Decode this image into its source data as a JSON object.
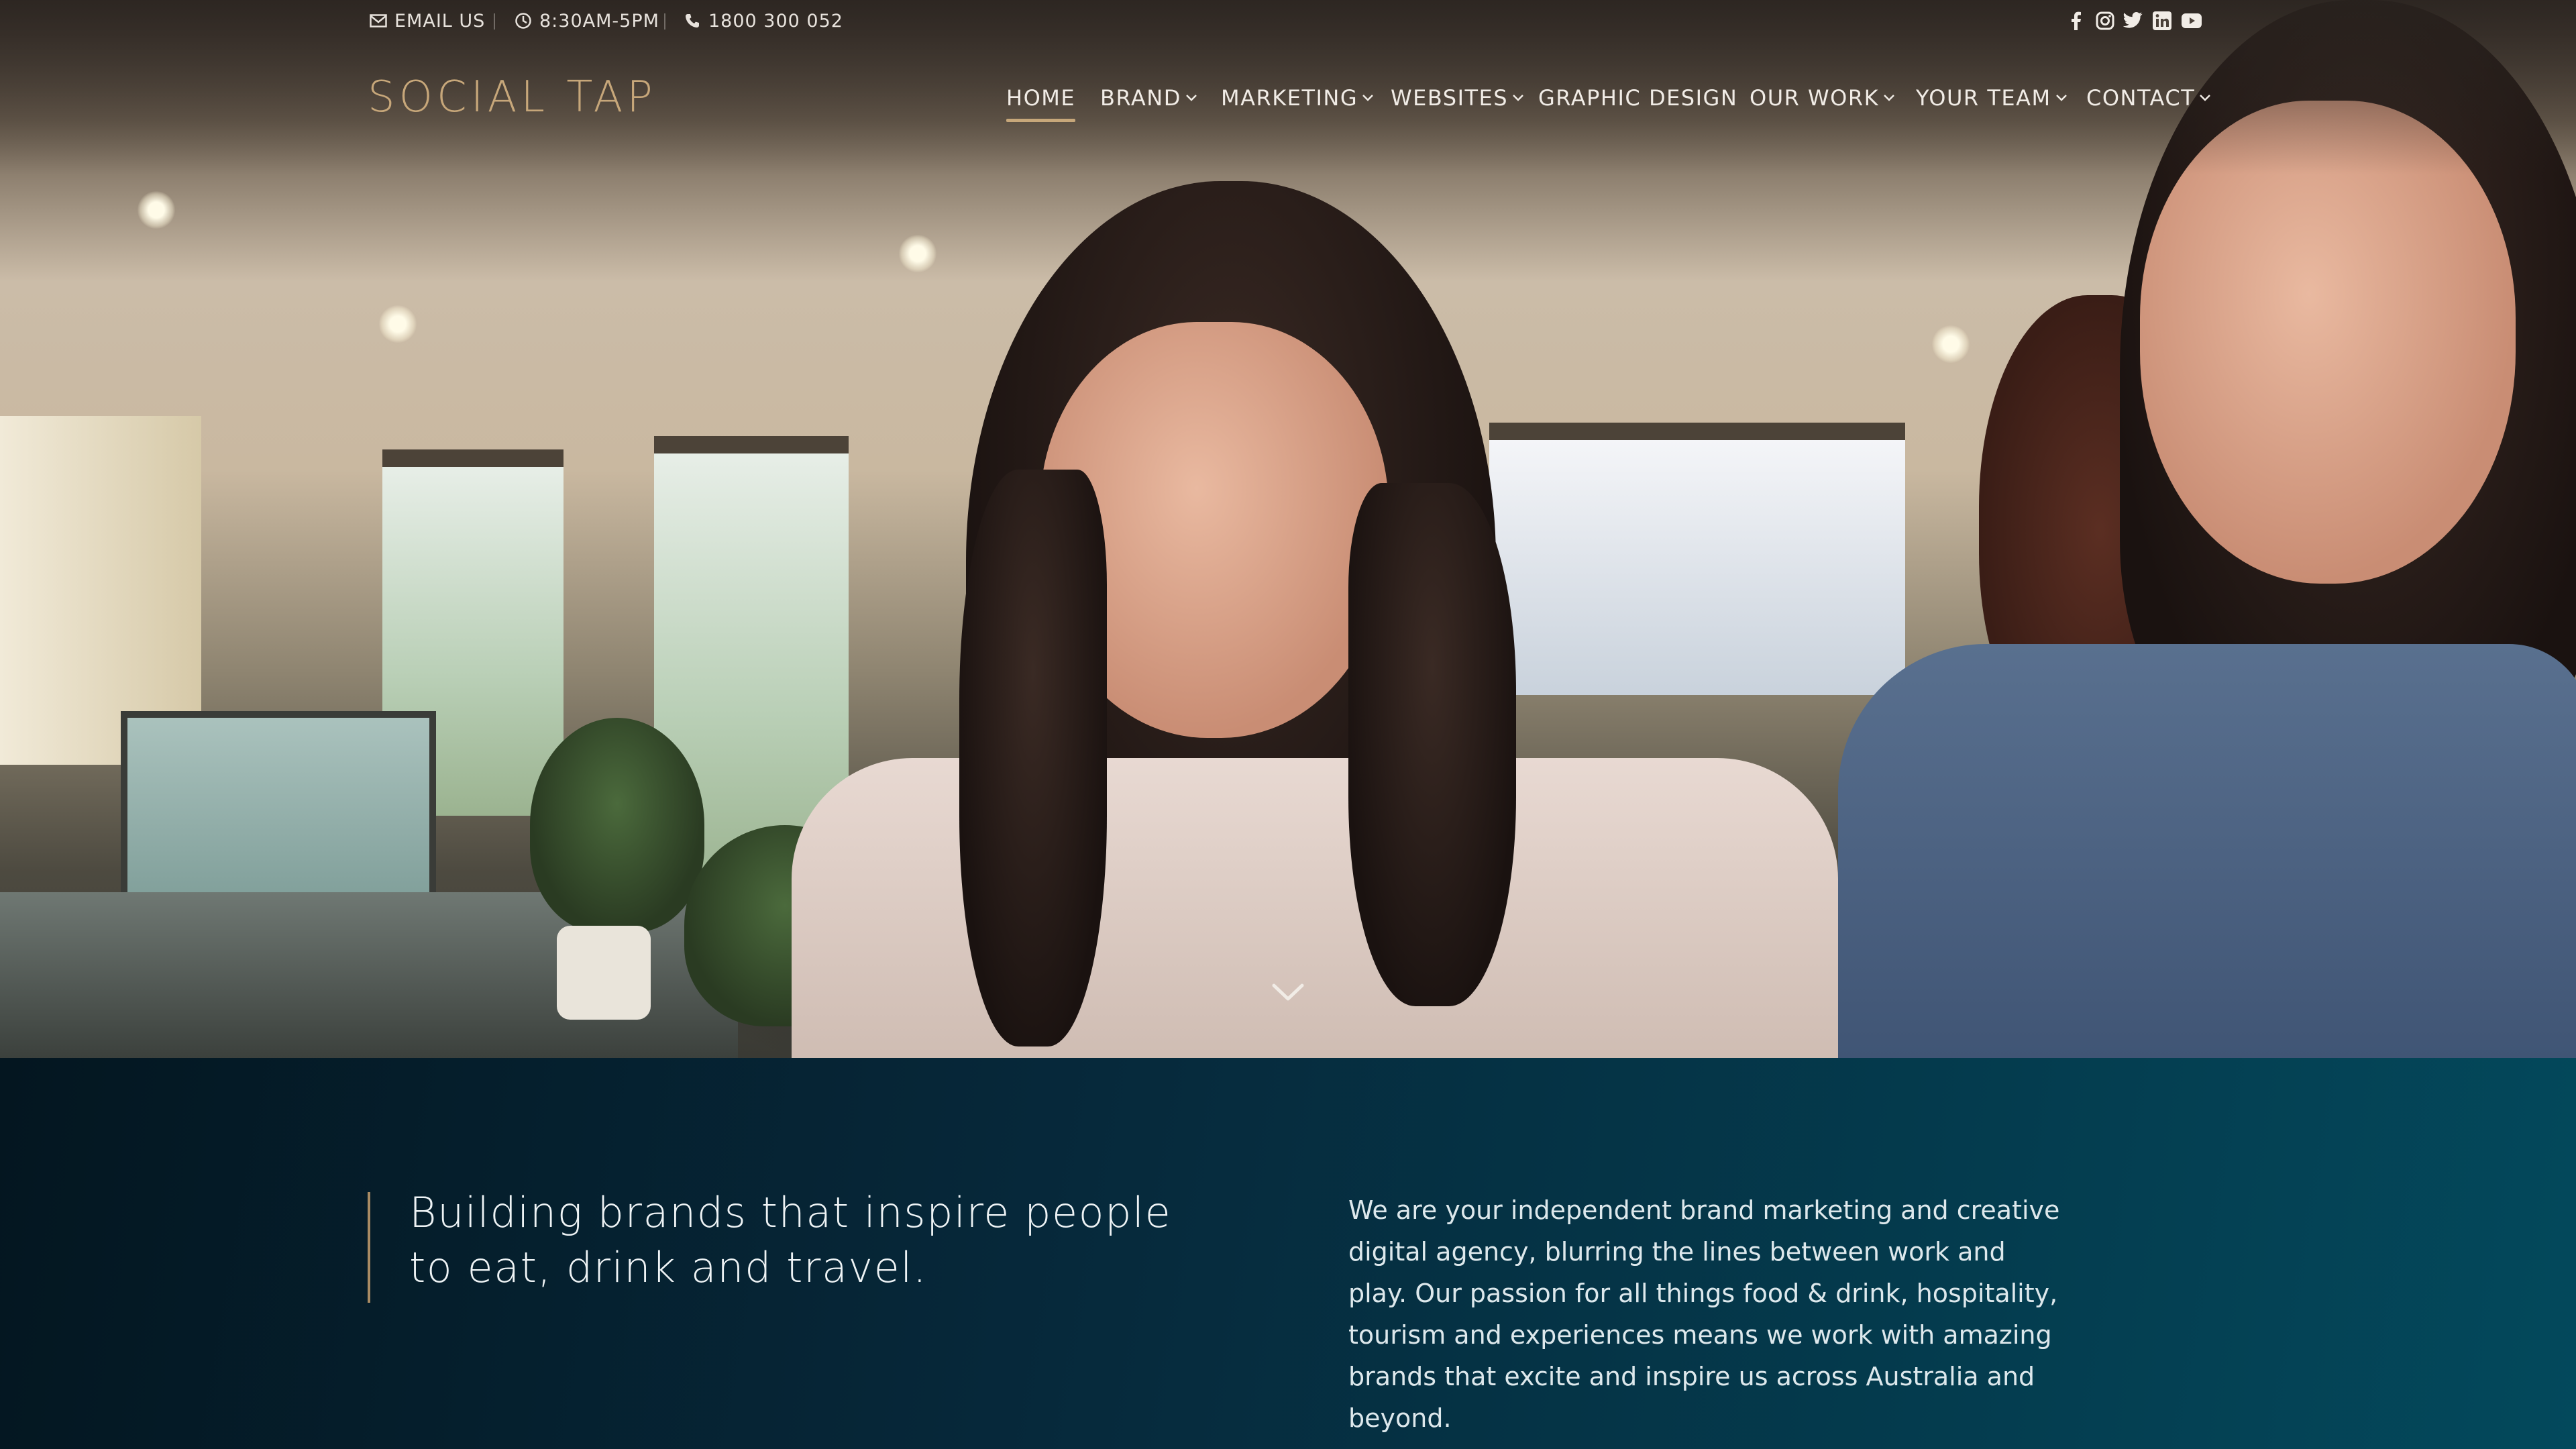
{
  "topbar": {
    "email_label": "EMAIL US",
    "hours_label": "8:30AM-5PM",
    "phone_label": "1800 300 052",
    "social_icons": [
      "facebook-icon",
      "instagram-icon",
      "twitter-icon",
      "linkedin-icon",
      "youtube-icon"
    ]
  },
  "header": {
    "logo_text": "SOCIAL TAP"
  },
  "nav": {
    "items": [
      {
        "label": "HOME",
        "active": true,
        "has_dropdown": false
      },
      {
        "label": "BRAND",
        "active": false,
        "has_dropdown": true
      },
      {
        "label": "MARKETING",
        "active": false,
        "has_dropdown": true
      },
      {
        "label": "WEBSITES",
        "active": false,
        "has_dropdown": true
      },
      {
        "label": "GRAPHIC DESIGN",
        "active": false,
        "has_dropdown": false
      },
      {
        "label": "OUR WORK",
        "active": false,
        "has_dropdown": true
      },
      {
        "label": "YOUR TEAM",
        "active": false,
        "has_dropdown": true
      },
      {
        "label": "CONTACT",
        "active": false,
        "has_dropdown": true
      }
    ]
  },
  "intro": {
    "heading": "Building brands that inspire people to eat, drink and travel.",
    "body": "We are your independent brand marketing and creative digital agency, blurring the lines between work and play. Our passion for all things food & drink, hospitality, tourism and experiences means we work with amazing brands that excite and inspire us across Australia and beyond."
  },
  "colors": {
    "accent_gold": "#c7a77a",
    "intro_bg_dark": "#041620",
    "intro_bg_teal": "#03495c"
  }
}
